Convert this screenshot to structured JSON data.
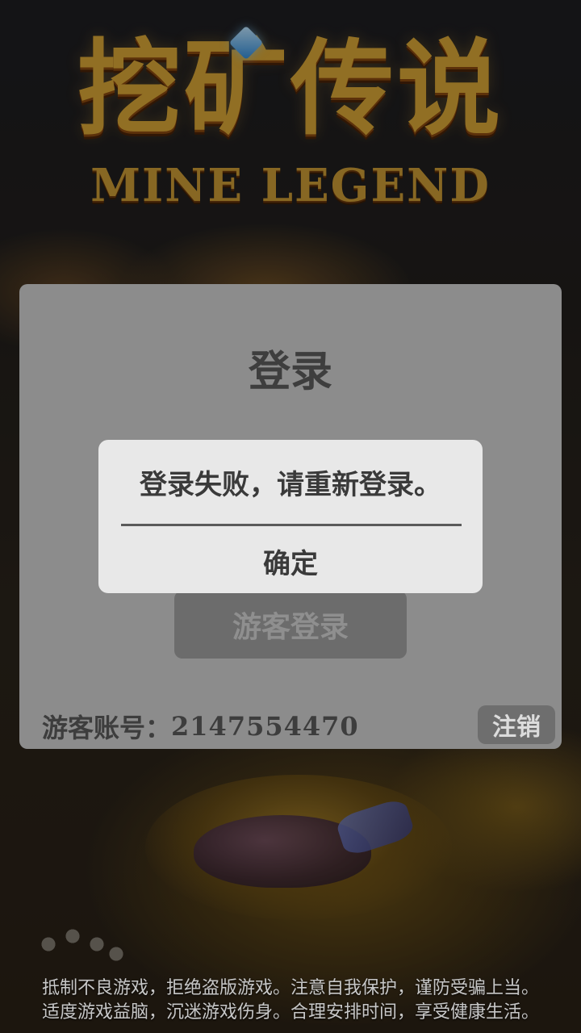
{
  "logo": {
    "title_cn": "挖矿传说",
    "title_en": "MINE LEGEND"
  },
  "login": {
    "title": "登录",
    "guest_button": "游客登录",
    "account_label": "游客账号：",
    "account_id": "2147554470",
    "logout_button": "注销"
  },
  "dialog": {
    "message": "登录失败，请重新登录。",
    "confirm_button": "确定"
  },
  "footer": {
    "line1": "抵制不良游戏，拒绝盗版游戏。注意自我保护，谨防受骗上当。",
    "line2": "适度游戏益脑，沉迷游戏伤身。合理安排时间，享受健康生活。"
  },
  "colors": {
    "panel": "#8c8c8c",
    "dialog": "#e8e8e8",
    "logo_gold": "#d8a636"
  }
}
